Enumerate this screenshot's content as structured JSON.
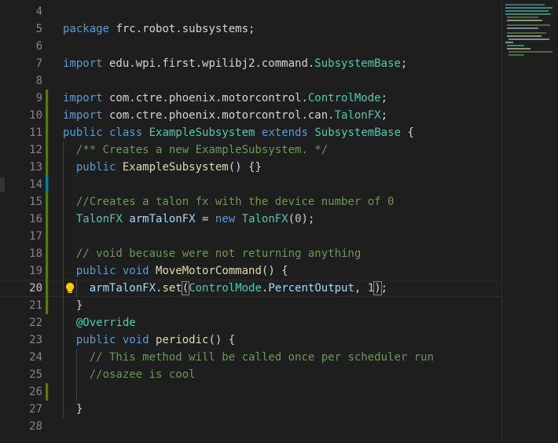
{
  "editor": {
    "lines": [
      {
        "n": "4",
        "segments": []
      },
      {
        "n": "5",
        "segments": [
          {
            "c": "k",
            "t": "package"
          },
          {
            "c": "p",
            "t": " frc.robot.subsystems;"
          }
        ]
      },
      {
        "n": "6",
        "segments": []
      },
      {
        "n": "7",
        "segments": [
          {
            "c": "k",
            "t": "import"
          },
          {
            "c": "p",
            "t": " edu.wpi.first.wpilibj2.command."
          },
          {
            "c": "t",
            "t": "SubsystemBase"
          },
          {
            "c": "p",
            "t": ";"
          }
        ]
      },
      {
        "n": "8",
        "segments": []
      },
      {
        "n": "9",
        "segments": [
          {
            "c": "k",
            "t": "import"
          },
          {
            "c": "p",
            "t": " com.ctre.phoenix.motorcontrol."
          },
          {
            "c": "t",
            "t": "ControlMode"
          },
          {
            "c": "p",
            "t": ";"
          }
        ]
      },
      {
        "n": "10",
        "segments": [
          {
            "c": "k",
            "t": "import"
          },
          {
            "c": "p",
            "t": " com.ctre.phoenix.motorcontrol.can."
          },
          {
            "c": "t",
            "t": "TalonFX"
          },
          {
            "c": "p",
            "t": ";"
          }
        ]
      },
      {
        "n": "11",
        "segments": [
          {
            "c": "k",
            "t": "public"
          },
          {
            "c": "p",
            "t": " "
          },
          {
            "c": "k",
            "t": "class"
          },
          {
            "c": "p",
            "t": " "
          },
          {
            "c": "t",
            "t": "ExampleSubsystem"
          },
          {
            "c": "p",
            "t": " "
          },
          {
            "c": "k",
            "t": "extends"
          },
          {
            "c": "p",
            "t": " "
          },
          {
            "c": "t",
            "t": "SubsystemBase"
          },
          {
            "c": "p",
            "t": " {"
          }
        ]
      },
      {
        "n": "12",
        "segments": [
          {
            "c": "p",
            "t": "  "
          },
          {
            "c": "c",
            "t": "/** Creates a new ExampleSubsystem. */"
          }
        ]
      },
      {
        "n": "13",
        "segments": [
          {
            "c": "p",
            "t": "  "
          },
          {
            "c": "k",
            "t": "public"
          },
          {
            "c": "p",
            "t": " "
          },
          {
            "c": "f",
            "t": "ExampleSubsystem"
          },
          {
            "c": "p",
            "t": "() {}"
          }
        ]
      },
      {
        "n": "14",
        "segments": []
      },
      {
        "n": "15",
        "segments": [
          {
            "c": "p",
            "t": "  "
          },
          {
            "c": "c",
            "t": "//Creates a talon fx with the device number of 0"
          }
        ]
      },
      {
        "n": "16",
        "segments": [
          {
            "c": "p",
            "t": "  "
          },
          {
            "c": "t",
            "t": "TalonFX"
          },
          {
            "c": "p",
            "t": " "
          },
          {
            "c": "v",
            "t": "armTalonFX"
          },
          {
            "c": "p",
            "t": " = "
          },
          {
            "c": "k",
            "t": "new"
          },
          {
            "c": "p",
            "t": " "
          },
          {
            "c": "t",
            "t": "TalonFX"
          },
          {
            "c": "p",
            "t": "("
          },
          {
            "c": "n",
            "t": "0"
          },
          {
            "c": "p",
            "t": ");"
          }
        ]
      },
      {
        "n": "17",
        "segments": []
      },
      {
        "n": "18",
        "segments": [
          {
            "c": "p",
            "t": "  "
          },
          {
            "c": "c",
            "t": "// void because were not returning anything"
          }
        ]
      },
      {
        "n": "19",
        "segments": [
          {
            "c": "p",
            "t": "  "
          },
          {
            "c": "k",
            "t": "public"
          },
          {
            "c": "p",
            "t": " "
          },
          {
            "c": "k",
            "t": "void"
          },
          {
            "c": "p",
            "t": " "
          },
          {
            "c": "f",
            "t": "MoveMotorCommand"
          },
          {
            "c": "p",
            "t": "() {"
          }
        ]
      },
      {
        "n": "20",
        "segments": [
          {
            "c": "p",
            "t": "    "
          },
          {
            "c": "v",
            "t": "armTalonFX"
          },
          {
            "c": "p",
            "t": "."
          },
          {
            "c": "f",
            "t": "set"
          },
          {
            "c": "p bm",
            "t": "("
          },
          {
            "c": "t",
            "t": "ControlMode"
          },
          {
            "c": "p",
            "t": "."
          },
          {
            "c": "v",
            "t": "PercentOutput"
          },
          {
            "c": "p",
            "t": ", "
          },
          {
            "c": "n",
            "t": "1"
          },
          {
            "c": "cursor",
            "t": ""
          },
          {
            "c": "p bm",
            "t": ")"
          },
          {
            "c": "p",
            "t": ";"
          }
        ]
      },
      {
        "n": "21",
        "segments": [
          {
            "c": "p",
            "t": "  }"
          }
        ]
      },
      {
        "n": "22",
        "segments": [
          {
            "c": "p",
            "t": "  "
          },
          {
            "c": "t",
            "t": "@Override"
          }
        ]
      },
      {
        "n": "23",
        "segments": [
          {
            "c": "p",
            "t": "  "
          },
          {
            "c": "k",
            "t": "public"
          },
          {
            "c": "p",
            "t": " "
          },
          {
            "c": "k",
            "t": "void"
          },
          {
            "c": "p",
            "t": " "
          },
          {
            "c": "f",
            "t": "periodic"
          },
          {
            "c": "p",
            "t": "() {"
          }
        ]
      },
      {
        "n": "24",
        "segments": [
          {
            "c": "p",
            "t": "    "
          },
          {
            "c": "c",
            "t": "// This method will be called once per scheduler run"
          }
        ]
      },
      {
        "n": "25",
        "segments": [
          {
            "c": "p",
            "t": "    "
          },
          {
            "c": "c",
            "t": "//osazee is cool"
          }
        ]
      },
      {
        "n": "26",
        "segments": []
      },
      {
        "n": "27",
        "segments": [
          {
            "c": "p",
            "t": "  }"
          }
        ]
      },
      {
        "n": "28",
        "segments": []
      }
    ],
    "current_line": "20",
    "lightbulb_icon": "lightbulb-icon",
    "colors": {
      "background": "#1e1e1e",
      "keyword": "#569cd6",
      "type": "#4ec9b0",
      "function": "#dcdcaa",
      "variable": "#9cdcfe",
      "number": "#b5cea8",
      "comment": "#6a9955",
      "gutter_added": "#587c0c",
      "gutter_modified": "#0c7d9d"
    },
    "gutter_marks": {
      "9": "added",
      "10": "added",
      "11": "added",
      "12": "added",
      "13": "added",
      "14": "modified",
      "15": "added",
      "16": "added",
      "17": "added",
      "18": "added",
      "19": "added",
      "20": "added",
      "21": "added",
      "26": "added"
    }
  }
}
